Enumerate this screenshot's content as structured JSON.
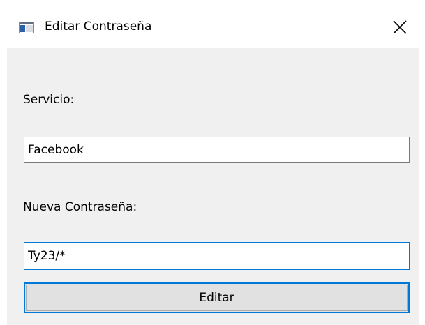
{
  "window": {
    "title": "Editar Contraseña",
    "icon": "app-window-icon",
    "close_icon": "close-icon"
  },
  "form": {
    "service_label": "Servicio:",
    "service_value": "Facebook",
    "new_password_label": "Nueva Contraseña:",
    "new_password_value": "Ty23/*",
    "edit_button_label": "Editar"
  },
  "colors": {
    "focus_accent": "#0078d7",
    "window_background": "#f0f0f0",
    "titlebar_background": "#ffffff"
  }
}
